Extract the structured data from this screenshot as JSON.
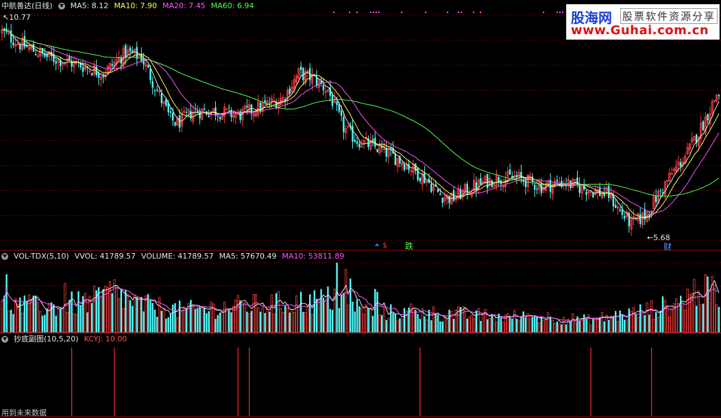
{
  "main_panel": {
    "stock_name": "中航善达(日线)",
    "indicators": [
      {
        "label": "MA5: 8.12",
        "color": "#e8e8e8"
      },
      {
        "label": "MA10: 7.90",
        "color": "#ffff55"
      },
      {
        "label": "MA20: 7.45",
        "color": "#ff55ff"
      },
      {
        "label": "MA60: 6.94",
        "color": "#55ff55"
      }
    ],
    "price_high_label": "10.77",
    "price_low_label": "5.68",
    "signal_up_glyph": "⏶",
    "signal_dollar": "$",
    "signal_fall": "跌",
    "signal_cai": "财"
  },
  "volume_panel": {
    "name": "VOL-TDX(5,10)",
    "vvol": "VVOL: 41789.57",
    "volume": "VOLUME: 41789.57",
    "ma5": "MA5: 57670.49",
    "ma10": "MA10: 53811.89"
  },
  "indicator_panel": {
    "name": "抄底副图(10,5,20)",
    "kcyj": "KCYJ: 10.00"
  },
  "logo": {
    "name": "股海网",
    "subtitle": "股票软件资源分享",
    "url": "www.Guhai.com.cn"
  },
  "footer": {
    "text": "用到未来数据"
  },
  "colors": {
    "up": "#ff4040",
    "down": "#54fcfc",
    "ma5": "#e8e8e8",
    "ma10": "#ffff55",
    "ma20": "#ff55ff",
    "ma60": "#55ff55",
    "grid": "#7a0000",
    "separator": "#a00000"
  },
  "chart_data": {
    "type": "candlestick",
    "price_anchors": [
      [
        0,
        10.5
      ],
      [
        8,
        10.2
      ],
      [
        20,
        9.9
      ],
      [
        35,
        9.7
      ],
      [
        45,
        9.5
      ],
      [
        55,
        10.0
      ],
      [
        62,
        9.9
      ],
      [
        68,
        9.2
      ],
      [
        75,
        8.4
      ],
      [
        78,
        8.3
      ],
      [
        85,
        8.6
      ],
      [
        95,
        8.6
      ],
      [
        105,
        8.5
      ],
      [
        115,
        8.7
      ],
      [
        125,
        8.9
      ],
      [
        132,
        9.5
      ],
      [
        138,
        9.4
      ],
      [
        145,
        9.1
      ],
      [
        152,
        8.2
      ],
      [
        158,
        7.9
      ],
      [
        168,
        7.7
      ],
      [
        178,
        7.4
      ],
      [
        188,
        7.0
      ],
      [
        195,
        6.6
      ],
      [
        200,
        6.5
      ],
      [
        210,
        6.8
      ],
      [
        220,
        7.0
      ],
      [
        230,
        7.0
      ],
      [
        240,
        6.8
      ],
      [
        250,
        6.9
      ],
      [
        262,
        6.7
      ],
      [
        270,
        6.6
      ],
      [
        275,
        6.2
      ],
      [
        280,
        5.9
      ],
      [
        286,
        6.1
      ],
      [
        292,
        6.6
      ],
      [
        298,
        7.1
      ],
      [
        305,
        7.6
      ],
      [
        312,
        8.3
      ],
      [
        318,
        9.0
      ]
    ],
    "volume_anchors": [
      [
        0,
        0.45
      ],
      [
        20,
        0.4
      ],
      [
        40,
        0.5
      ],
      [
        50,
        0.65
      ],
      [
        60,
        0.45
      ],
      [
        80,
        0.35
      ],
      [
        100,
        0.4
      ],
      [
        120,
        0.45
      ],
      [
        140,
        0.5
      ],
      [
        150,
        0.55
      ],
      [
        160,
        0.35
      ],
      [
        180,
        0.3
      ],
      [
        200,
        0.3
      ],
      [
        220,
        0.25
      ],
      [
        240,
        0.25
      ],
      [
        260,
        0.2
      ],
      [
        280,
        0.3
      ],
      [
        300,
        0.45
      ],
      [
        310,
        0.7
      ],
      [
        318,
        0.55
      ]
    ],
    "volume_spike": {
      "index": 149,
      "level": 1.0
    },
    "kcyj_signal_indices": [
      31,
      50,
      105,
      110,
      186,
      262,
      289
    ],
    "bar_count": 320
  }
}
